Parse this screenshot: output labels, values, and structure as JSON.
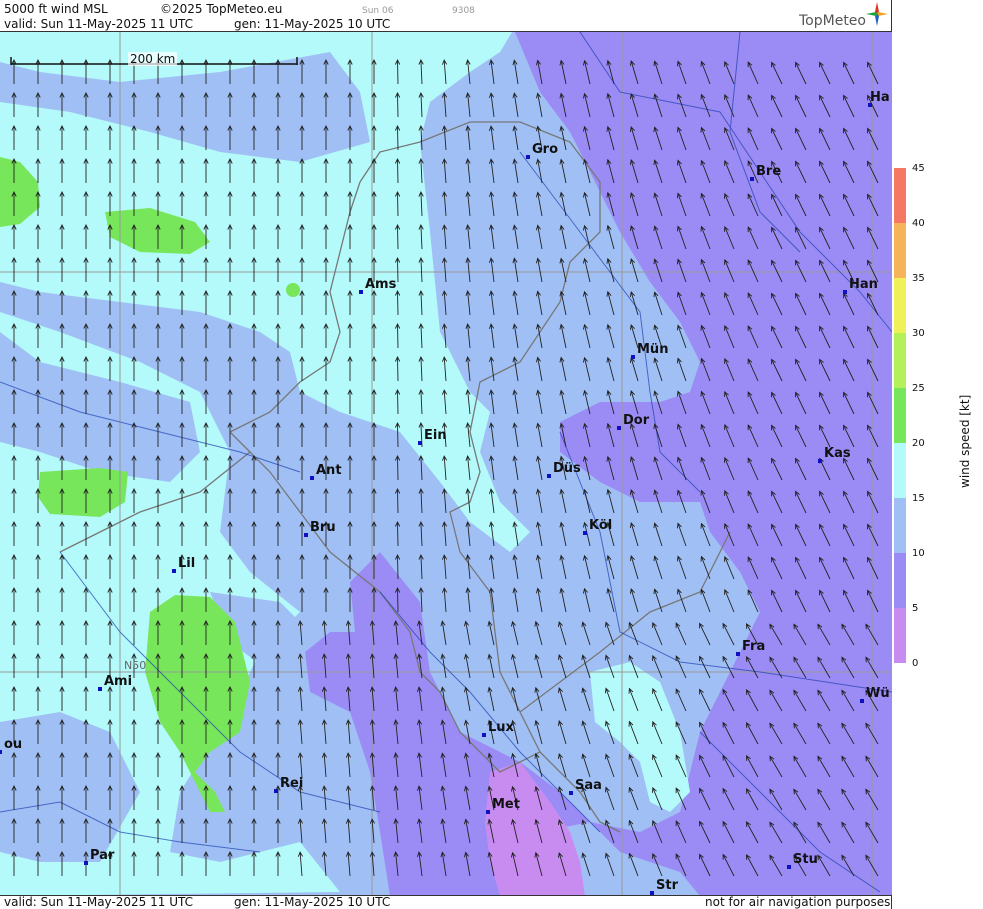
{
  "header": {
    "product": "5000 ft wind MSL",
    "copyright": "©2025 TopMeteo.eu",
    "day": "Sun 06",
    "code": "9308",
    "valid": "valid:  Sun  11-May-2025  11 UTC",
    "gen": "gen: 11-May-2025 10 UTC"
  },
  "footer": {
    "valid": "valid:  Sun  11-May-2025  11 UTC",
    "gen": "gen: 11-May-2025 10 UTC",
    "disclaimer": "not for air navigation purposes"
  },
  "logo": {
    "text": "TopMeteo",
    "icon": "compass-star-icon"
  },
  "scale": {
    "label": "200 km"
  },
  "lat_label": "N50",
  "legend": {
    "title": "wind  speed  [kt]",
    "ticks": [
      "45",
      "40",
      "35",
      "30",
      "25",
      "20",
      "15",
      "10",
      "5",
      "0"
    ],
    "colors": {
      "0-5": "#c88cf0",
      "5-10": "#9b8cf5",
      "10-15": "#a0c0f5",
      "15-20": "#b4fafa",
      "20-25": "#78e65a",
      "25-30": "#b4f05a",
      "30-35": "#f0f05a",
      "35-40": "#f5b45a",
      "40-45": "#f57864"
    }
  },
  "cities": [
    {
      "name": "Gro"
    },
    {
      "name": "Bre"
    },
    {
      "name": "Ha"
    },
    {
      "name": "Ams"
    },
    {
      "name": "Han"
    },
    {
      "name": "Mün"
    },
    {
      "name": "Dor"
    },
    {
      "name": "Ein"
    },
    {
      "name": "Ant"
    },
    {
      "name": "Düs"
    },
    {
      "name": "Kas"
    },
    {
      "name": "Bru"
    },
    {
      "name": "Köl"
    },
    {
      "name": "Lil"
    },
    {
      "name": "Fra"
    },
    {
      "name": "Ami"
    },
    {
      "name": "Wü"
    },
    {
      "name": "Lux"
    },
    {
      "name": "ou"
    },
    {
      "name": "Rei"
    },
    {
      "name": "Saa"
    },
    {
      "name": "Met"
    },
    {
      "name": "Par"
    },
    {
      "name": "Stu"
    },
    {
      "name": "Str"
    }
  ]
}
